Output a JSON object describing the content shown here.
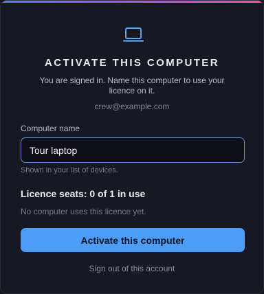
{
  "dialog": {
    "accent_colors": [
      "#5b7cff",
      "#9a5cf0",
      "#ef5aa0"
    ],
    "icon": "laptop-icon",
    "title": "ACTIVATE THIS COMPUTER",
    "subtitle": "You are signed in. Name this computer to use your licence on it.",
    "email": "crew@example.com"
  },
  "form": {
    "computer_name_label": "Computer name",
    "computer_name_value": "Tour laptop",
    "computer_name_hint": "Shown in your list of devices."
  },
  "licence": {
    "seats_text": "Licence seats: 0 of 1 in use",
    "note": "No computer uses this licence yet."
  },
  "actions": {
    "activate_label": "Activate this computer",
    "activate_color": "#4d9cf7",
    "sign_out_label": "Sign out of this account"
  }
}
